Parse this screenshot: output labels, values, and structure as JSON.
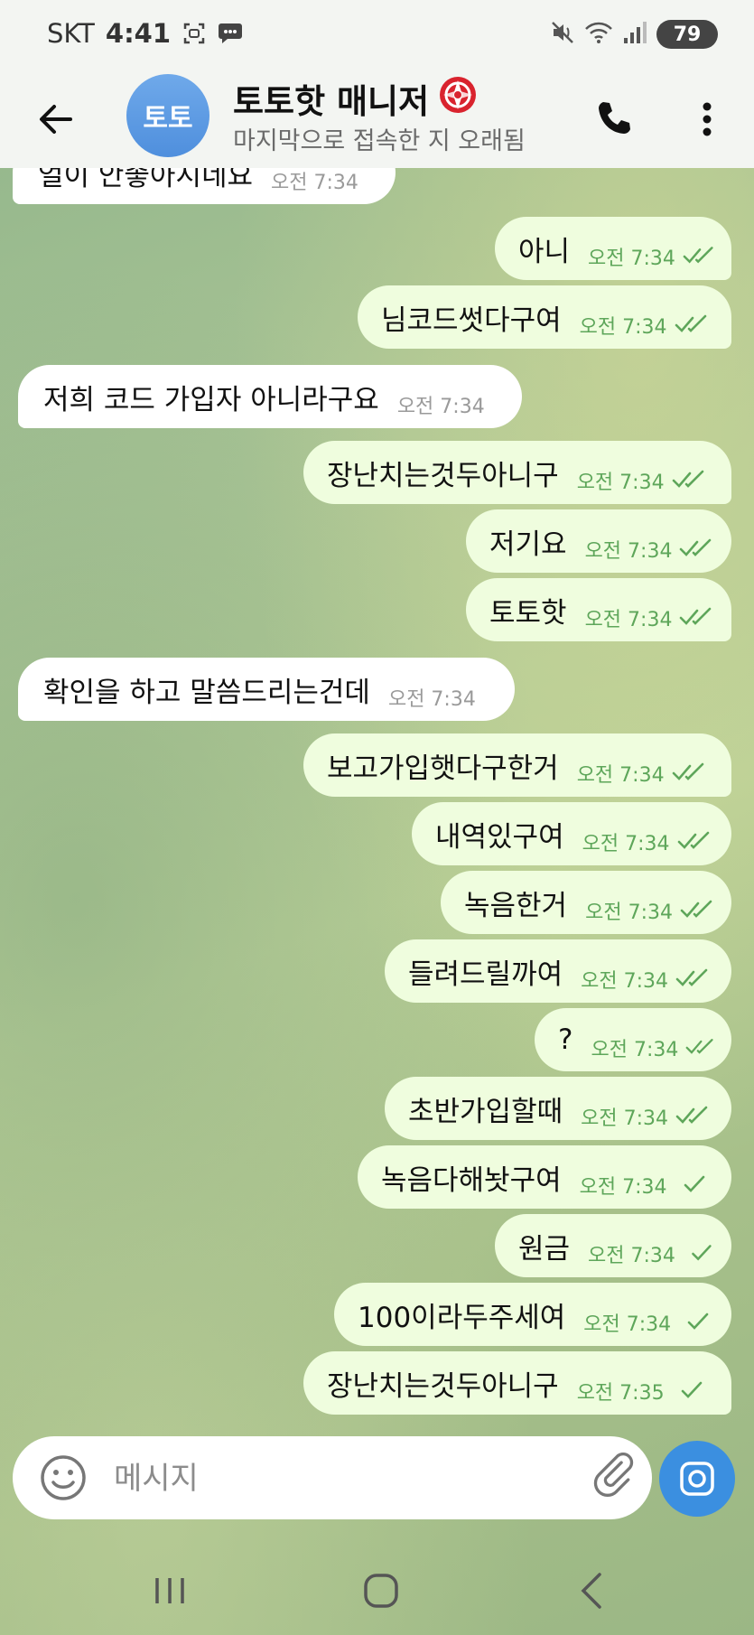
{
  "status_bar": {
    "carrier": "SKT",
    "time": "4:41",
    "battery": "79"
  },
  "header": {
    "avatar_text": "토토",
    "title": "토토핫 매니저",
    "subtitle": "마지막으로 접속한 지 오래됨"
  },
  "messages": [
    {
      "text": "얼이 안좋아시네요",
      "time": "오전 7:34",
      "dir": "in"
    },
    {
      "text": "아니",
      "time": "오전 7:34",
      "dir": "out",
      "read": true
    },
    {
      "text": "님코드썻다구여",
      "time": "오전 7:34",
      "dir": "out",
      "read": true
    },
    {
      "text": "저희 코드 가입자 아니라구요",
      "time": "오전 7:34",
      "dir": "in"
    },
    {
      "text": "장난치는것두아니구",
      "time": "오전 7:34",
      "dir": "out",
      "read": true
    },
    {
      "text": "저기요",
      "time": "오전 7:34",
      "dir": "out",
      "read": true
    },
    {
      "text": "토토핫",
      "time": "오전 7:34",
      "dir": "out",
      "read": true
    },
    {
      "text": "확인을 하고 말씀드리는건데",
      "time": "오전 7:34",
      "dir": "in"
    },
    {
      "text": "보고가입햇다구한거",
      "time": "오전 7:34",
      "dir": "out",
      "read": true
    },
    {
      "text": "내역있구여",
      "time": "오전 7:34",
      "dir": "out",
      "read": true
    },
    {
      "text": "녹음한거",
      "time": "오전 7:34",
      "dir": "out",
      "read": true
    },
    {
      "text": "들려드릴까여",
      "time": "오전 7:34",
      "dir": "out",
      "read": true
    },
    {
      "text": "?",
      "time": "오전 7:34",
      "dir": "out",
      "read": true
    },
    {
      "text": "초반가입할때",
      "time": "오전 7:34",
      "dir": "out",
      "read": true
    },
    {
      "text": "녹음다해놧구여",
      "time": "오전 7:34",
      "dir": "out",
      "read": false
    },
    {
      "text": "원금",
      "time": "오전 7:34",
      "dir": "out",
      "read": false
    },
    {
      "text": "100이라두주세여",
      "time": "오전 7:34",
      "dir": "out",
      "read": false
    },
    {
      "text": "장난치는것두아니구",
      "time": "오전 7:35",
      "dir": "out",
      "read": false
    }
  ],
  "input": {
    "placeholder": "메시지",
    "value": ""
  },
  "colors": {
    "outgoing_bubble": "#effdde",
    "incoming_bubble": "#ffffff",
    "check_color": "#5ea65a",
    "accent": "#3b8fe0"
  },
  "icons": {
    "back": "arrow-left-icon",
    "call": "phone-icon",
    "more": "more-vertical-icon",
    "emoji": "emoji-icon",
    "attach": "paperclip-icon",
    "camera": "camera-icon"
  }
}
